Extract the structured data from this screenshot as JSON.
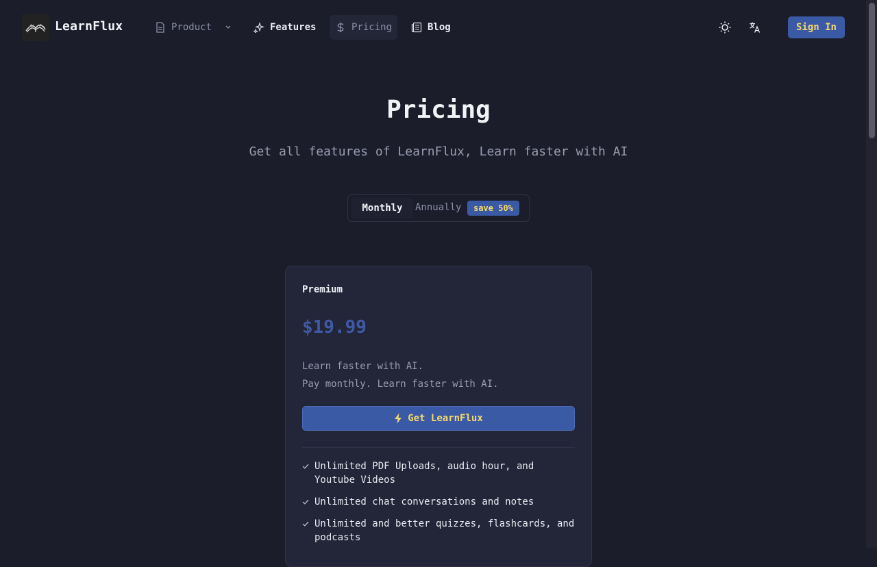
{
  "brand": {
    "name": "LearnFlux",
    "logo_icon": "book-icon"
  },
  "nav": {
    "product": {
      "label": "Product",
      "icon": "file-icon"
    },
    "features": {
      "label": "Features",
      "icon": "sparkles-icon"
    },
    "pricing": {
      "label": "Pricing",
      "icon": "dollar-icon"
    },
    "blog": {
      "label": "Blog",
      "icon": "newspaper-icon"
    }
  },
  "header_actions": {
    "theme_icon": "sun-icon",
    "language_icon": "translate-icon",
    "sign_in": "Sign In"
  },
  "page": {
    "title": "Pricing",
    "subtitle": "Get all features of LearnFlux, Learn faster with AI"
  },
  "billing_toggle": {
    "monthly": "Monthly",
    "annually": "Annually",
    "badge": "save 50%",
    "selected": "Monthly"
  },
  "plan": {
    "name": "Premium",
    "price": "$19.99",
    "description_1": "Learn faster with AI.",
    "description_2": "Pay monthly. Learn faster with AI.",
    "cta": "Get LearnFlux",
    "features": [
      "Unlimited PDF Uploads, audio hour, and Youtube Videos",
      "Unlimited chat conversations and notes",
      "Unlimited and better quizzes, flashcards, and podcasts"
    ]
  },
  "colors": {
    "background": "#1b1d2b",
    "accent": "#3b5aa6",
    "accent_text": "#f5d86a",
    "card": "#232539"
  }
}
